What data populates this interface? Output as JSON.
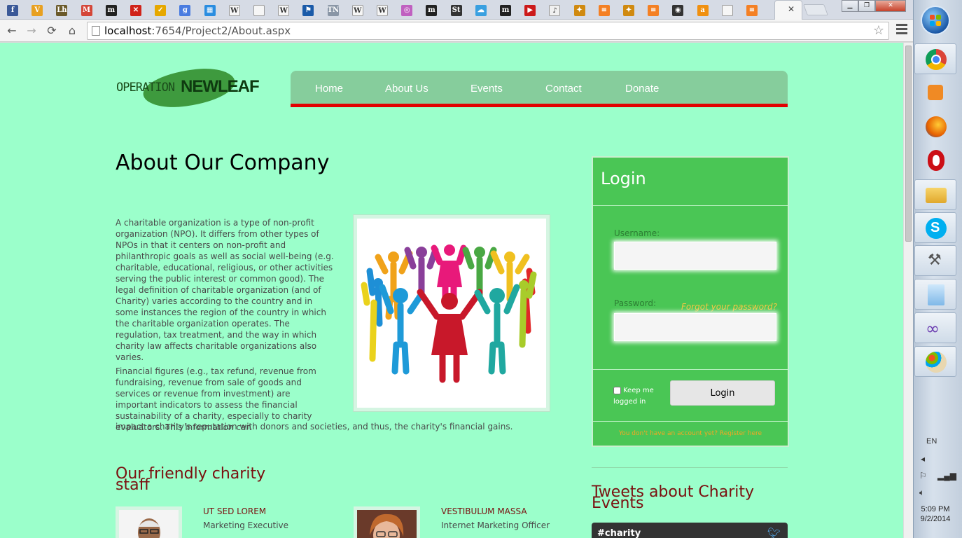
{
  "browser": {
    "tabs": [
      {
        "icon": "facebook-icon",
        "glyph": "f",
        "color": "#3b5998"
      },
      {
        "icon": "v-app-icon",
        "glyph": "V",
        "color": "#e8a020"
      },
      {
        "icon": "lh-icon",
        "glyph": "Lh",
        "color": "#6b5a2a"
      },
      {
        "icon": "gmail-icon",
        "glyph": "M",
        "color": "#d44638"
      },
      {
        "icon": "m-app-icon",
        "glyph": "m",
        "color": "#222222"
      },
      {
        "icon": "red-x-icon",
        "glyph": "✕",
        "color": "#d0231a"
      },
      {
        "icon": "checkmark-icon",
        "glyph": "✓",
        "color": "#e6a800"
      },
      {
        "icon": "google-icon",
        "glyph": "g",
        "color": "#4a7ce0"
      },
      {
        "icon": "windows-icon",
        "glyph": "▦",
        "color": "#2a8de0"
      },
      {
        "icon": "wikipedia-icon",
        "glyph": "W",
        "color": "#f6f6f6"
      },
      {
        "icon": "blank-page-icon",
        "glyph": "",
        "color": "#f6f6f6"
      },
      {
        "icon": "wikipedia-icon",
        "glyph": "W",
        "color": "#f6f6f6"
      },
      {
        "icon": "flag-icon",
        "glyph": "⚑",
        "color": "#1a5aa8"
      },
      {
        "icon": "tn-icon",
        "glyph": "TN",
        "color": "#8a96a6"
      },
      {
        "icon": "wikipedia-icon",
        "glyph": "W",
        "color": "#f6f6f6"
      },
      {
        "icon": "wikipedia-icon",
        "glyph": "W",
        "color": "#f6f6f6"
      },
      {
        "icon": "colorful-app-icon",
        "glyph": "◎",
        "color": "#c060c0"
      },
      {
        "icon": "m-app-icon",
        "glyph": "m",
        "color": "#222222"
      },
      {
        "icon": "st-icon",
        "glyph": "St",
        "color": "#333333"
      },
      {
        "icon": "cloud-icon",
        "glyph": "☁",
        "color": "#3aa0e0"
      },
      {
        "icon": "m-app-icon",
        "glyph": "m",
        "color": "#222222"
      },
      {
        "icon": "youtube-icon",
        "glyph": "▶",
        "color": "#cc1a1a"
      },
      {
        "icon": "audio-icon",
        "glyph": "♪",
        "color": "#f0f0f0"
      },
      {
        "icon": "badge-icon",
        "glyph": "✦",
        "color": "#d08a10"
      },
      {
        "icon": "stackoverflow-icon",
        "glyph": "≡",
        "color": "#f48024"
      },
      {
        "icon": "badge-icon",
        "glyph": "✦",
        "color": "#d08a10"
      },
      {
        "icon": "stackoverflow-icon",
        "glyph": "≡",
        "color": "#f48024"
      },
      {
        "icon": "dark-circle-icon",
        "glyph": "◉",
        "color": "#333333"
      },
      {
        "icon": "orange-a-icon",
        "glyph": "a",
        "color": "#f09010"
      },
      {
        "icon": "blank-page-icon",
        "glyph": "",
        "color": "#f6f6f6"
      },
      {
        "icon": "stackoverflow-icon",
        "glyph": "≡",
        "color": "#f48024"
      }
    ],
    "active_tab_close": "✕",
    "url_host": "localhost",
    "url_rest": ":7654/Project2/About.aspx"
  },
  "site": {
    "logo_operation": "OPERATION",
    "logo_newleaf": "NEWLEAF",
    "nav": [
      "Home",
      "About Us",
      "Events",
      "Contact",
      "Donate"
    ]
  },
  "main": {
    "heading": "About Our Company",
    "para1": "A charitable organization is a type of non-profit organization (NPO). It differs from other types of NPOs in that it centers on non-profit and philanthropic goals as well as social well-being (e.g. charitable, educational, religious, or other activities serving the public interest or common good). The legal definition of charitable organization (and of Charity) varies according to the country and in some instances the region of the country in which the charitable organization operates. The regulation, tax treatment, and the way in which charity law affects charitable organizations also varies.",
    "para2_wrapped": "Financial figures (e.g., tax refund, revenue from fundraising, revenue from sale of goods and services or revenue from investment) are important indicators to assess the financial sustainability of a charity, especially to charity evaluators. This information can",
    "para2_tail": "impact a charity's reputation with donors and societies, and thus, the charity's financial gains.",
    "staff_heading": "Our friendly charity staff",
    "staff": [
      {
        "name": "UT SED LOREM",
        "role": "Marketing Executive"
      },
      {
        "name": "VESTIBULUM MASSA",
        "role": "Internet Marketing Officer"
      }
    ]
  },
  "login": {
    "title": "Login",
    "username_label": "Username:",
    "password_label": "Password:",
    "forgot": "Forgot your password?",
    "keep": "Keep me logged in",
    "button": "Login",
    "register": "You don't have an account yet? Register here"
  },
  "sidebar": {
    "tweets_heading": "Tweets about Charity Events",
    "hashtag": "#charity"
  },
  "taskbar": {
    "language": "EN",
    "time": "5:09 PM",
    "date": "9/2/2014"
  },
  "colors": {
    "page_bg": "#9bffcb",
    "nav_bg": "#86cd9c",
    "nav_accent": "#e30000",
    "login_bg": "#4ac655",
    "heading_accent": "#7a1010"
  }
}
